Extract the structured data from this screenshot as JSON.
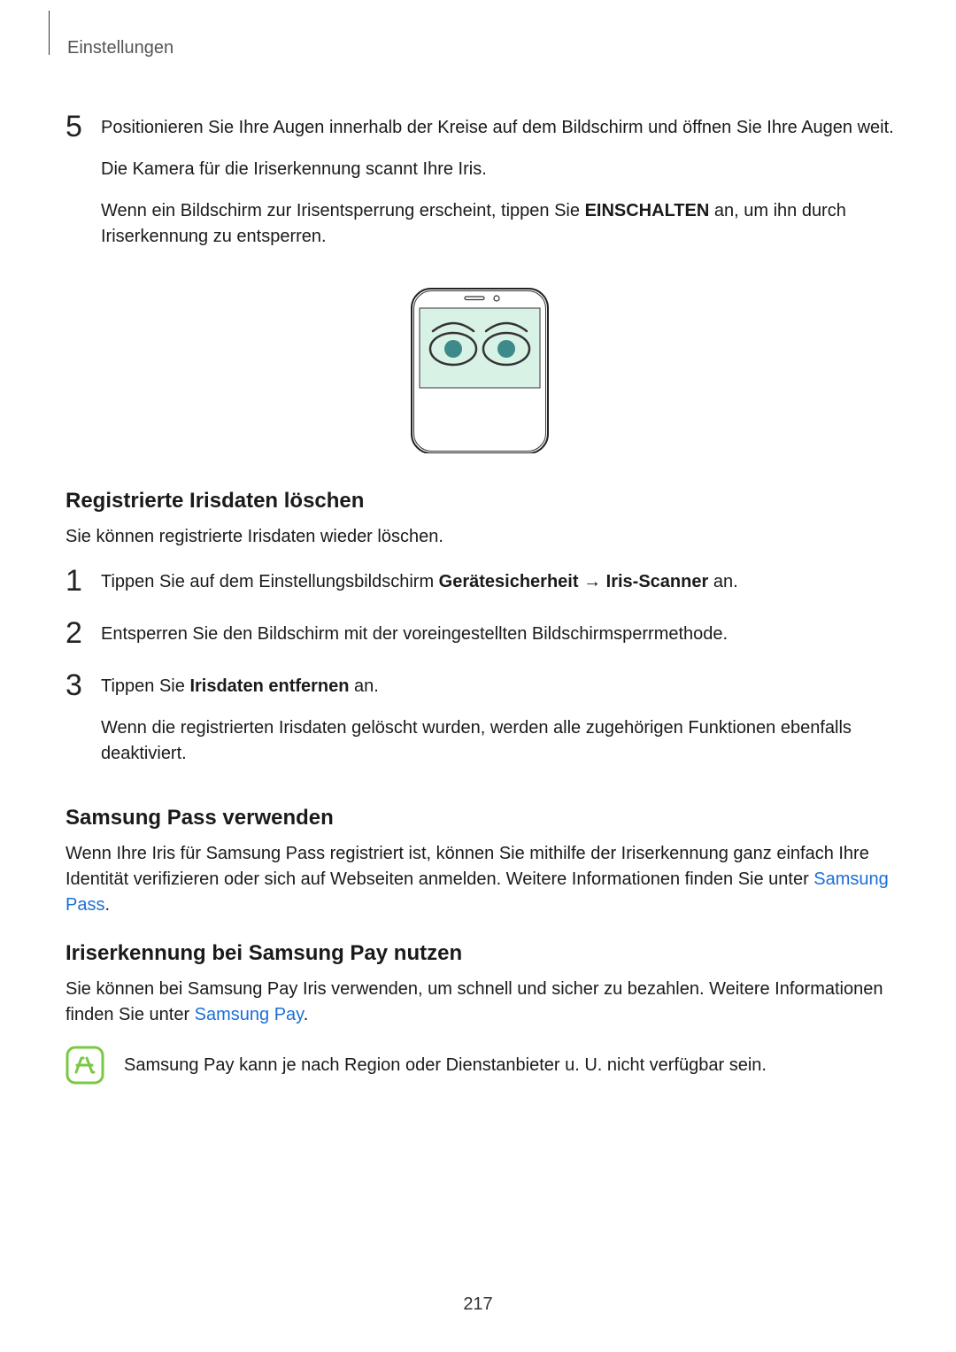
{
  "breadcrumb": "Einstellungen",
  "step5": {
    "num": "5",
    "p1_a": "Positionieren Sie Ihre Augen innerhalb der Kreise auf dem Bildschirm und öffnen Sie Ihre Augen weit.",
    "p2": "Die Kamera für die Iriserkennung scannt Ihre Iris.",
    "p3_a": "Wenn ein Bildschirm zur Irisentsperrung erscheint, tippen Sie ",
    "p3_bold": "EINSCHALTEN",
    "p3_b": " an, um ihn durch Iriserkennung zu entsperren."
  },
  "delete_section": {
    "heading": "Registrierte Irisdaten löschen",
    "intro": "Sie können registrierte Irisdaten wieder löschen.",
    "step1": {
      "num": "1",
      "a": "Tippen Sie auf dem Einstellungsbildschirm ",
      "b1": "Gerätesicherheit",
      "arrow": " → ",
      "b2": "Iris-Scanner",
      "c": " an."
    },
    "step2": {
      "num": "2",
      "text": "Entsperren Sie den Bildschirm mit der voreingestellten Bildschirmsperrmethode."
    },
    "step3": {
      "num": "3",
      "a": "Tippen Sie ",
      "b": "Irisdaten entfernen",
      "c": " an.",
      "p2": "Wenn die registrierten Irisdaten gelöscht wurden, werden alle zugehörigen Funktionen ebenfalls deaktiviert."
    }
  },
  "pass_section": {
    "heading": "Samsung Pass verwenden",
    "p_a": "Wenn Ihre Iris für Samsung Pass registriert ist, können Sie mithilfe der Iriserkennung ganz einfach Ihre Identität verifizieren oder sich auf Webseiten anmelden. Weitere Informationen finden Sie unter ",
    "link": "Samsung Pass",
    "p_b": "."
  },
  "pay_section": {
    "heading": "Iriserkennung bei Samsung Pay nutzen",
    "p_a": "Sie können bei Samsung Pay Iris verwenden, um schnell und sicher zu bezahlen. Weitere Informationen finden Sie unter ",
    "link": "Samsung Pay",
    "p_b": ".",
    "note": "Samsung Pay kann je nach Region oder Dienstanbieter u. U. nicht verfügbar sein."
  },
  "page_number": "217"
}
